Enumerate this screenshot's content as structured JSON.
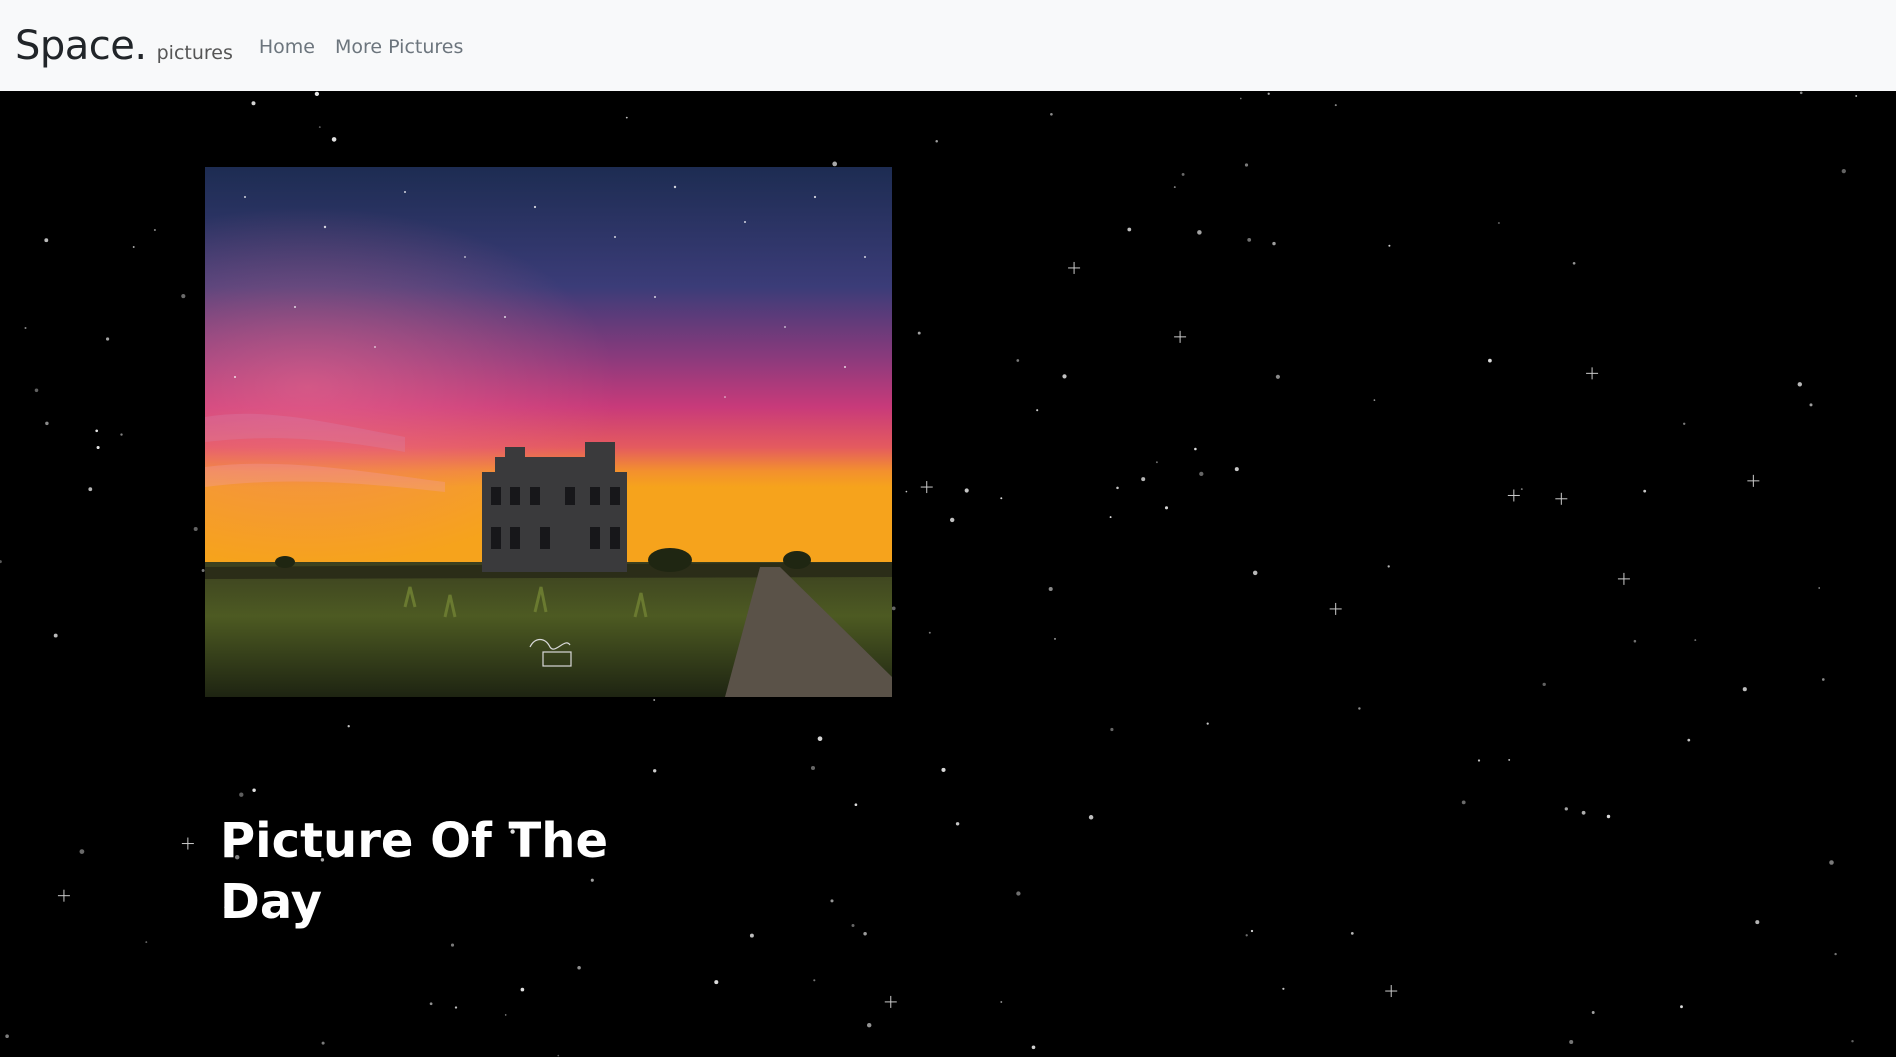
{
  "navbar": {
    "brand": "Space.",
    "brand_sub": "pictures",
    "links": [
      "Home",
      "More Pictures"
    ]
  },
  "main": {
    "image_alt": "Aurora over abandoned house",
    "title": "Picture Of The Day"
  },
  "colors": {
    "navbar_bg": "#f8f9fa",
    "page_bg": "#000000",
    "title_text": "#ffffff"
  }
}
